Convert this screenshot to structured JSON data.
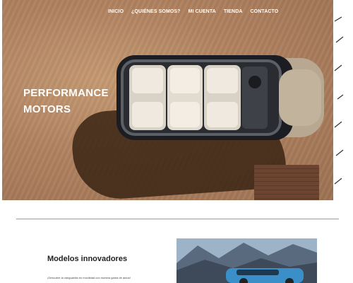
{
  "nav": {
    "items": [
      {
        "label": "INICIO"
      },
      {
        "label": "¿QUIÉNES SOMOS?"
      },
      {
        "label": "MI CUENTA"
      },
      {
        "label": "TIENDA"
      },
      {
        "label": "CONTACTO"
      }
    ]
  },
  "hero": {
    "title_line1": "PERFORMANCE",
    "title_line2": "MOTORS"
  },
  "section": {
    "title": "Modelos innovadores",
    "text": "¡Descubre la vanguardia en movilidad con nuestra gama de autos!"
  },
  "colors": {
    "sand": "#b08260",
    "car_body": "#b7a792",
    "nav_text": "#ffffff"
  }
}
